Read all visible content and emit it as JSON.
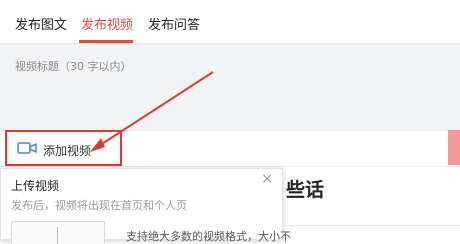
{
  "tabs": [
    {
      "label": "发布图文",
      "active": false
    },
    {
      "label": "发布视频",
      "active": true
    },
    {
      "label": "发布问答",
      "active": false
    }
  ],
  "title_input": {
    "placeholder": "视频标题（30 字以内）"
  },
  "add_video": {
    "label": "添加视频",
    "icon": "video-camera-icon"
  },
  "popup": {
    "title": "上传视频",
    "close": "×",
    "description": "发布后，视频将出现在首页和个人页",
    "hint": "支持绝大多数的视频格式，大小不"
  },
  "background_heading": "些话",
  "colors": {
    "accent": "#e8453c",
    "annotation": "#d93b34"
  }
}
